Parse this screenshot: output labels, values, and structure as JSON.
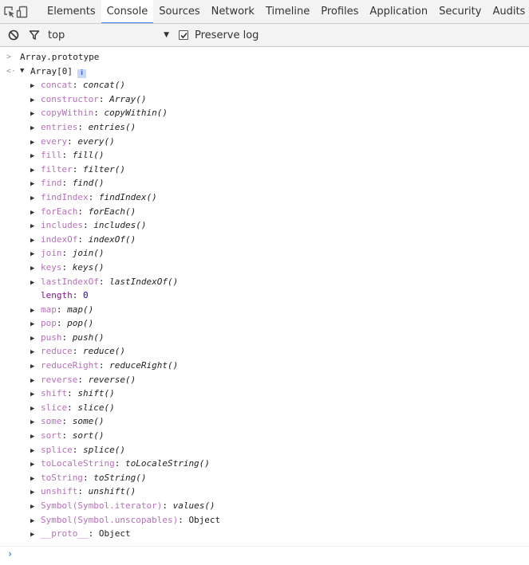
{
  "tabs": [
    {
      "label": "Elements",
      "active": false
    },
    {
      "label": "Console",
      "active": true
    },
    {
      "label": "Sources",
      "active": false
    },
    {
      "label": "Network",
      "active": false
    },
    {
      "label": "Timeline",
      "active": false
    },
    {
      "label": "Profiles",
      "active": false
    },
    {
      "label": "Application",
      "active": false
    },
    {
      "label": "Security",
      "active": false
    },
    {
      "label": "Audits",
      "active": false
    }
  ],
  "toolbar": {
    "context": "top",
    "preserve_log_label": "Preserve log",
    "preserve_log_checked": true
  },
  "console": {
    "input": "Array.prototype",
    "result_head": "Array[0]",
    "info_badge": "i",
    "props": [
      {
        "key": "concat",
        "value": "concat()",
        "kind": "fn",
        "expandable": true
      },
      {
        "key": "constructor",
        "value": "Array()",
        "kind": "fn",
        "expandable": true
      },
      {
        "key": "copyWithin",
        "value": "copyWithin()",
        "kind": "fn",
        "expandable": true
      },
      {
        "key": "entries",
        "value": "entries()",
        "kind": "fn",
        "expandable": true
      },
      {
        "key": "every",
        "value": "every()",
        "kind": "fn",
        "expandable": true
      },
      {
        "key": "fill",
        "value": "fill()",
        "kind": "fn",
        "expandable": true
      },
      {
        "key": "filter",
        "value": "filter()",
        "kind": "fn",
        "expandable": true
      },
      {
        "key": "find",
        "value": "find()",
        "kind": "fn",
        "expandable": true
      },
      {
        "key": "findIndex",
        "value": "findIndex()",
        "kind": "fn",
        "expandable": true
      },
      {
        "key": "forEach",
        "value": "forEach()",
        "kind": "fn",
        "expandable": true
      },
      {
        "key": "includes",
        "value": "includes()",
        "kind": "fn",
        "expandable": true
      },
      {
        "key": "indexOf",
        "value": "indexOf()",
        "kind": "fn",
        "expandable": true
      },
      {
        "key": "join",
        "value": "join()",
        "kind": "fn",
        "expandable": true
      },
      {
        "key": "keys",
        "value": "keys()",
        "kind": "fn",
        "expandable": true
      },
      {
        "key": "lastIndexOf",
        "value": "lastIndexOf()",
        "kind": "fn",
        "expandable": true
      },
      {
        "key": "length",
        "value": "0",
        "kind": "num",
        "expandable": false
      },
      {
        "key": "map",
        "value": "map()",
        "kind": "fn",
        "expandable": true
      },
      {
        "key": "pop",
        "value": "pop()",
        "kind": "fn",
        "expandable": true
      },
      {
        "key": "push",
        "value": "push()",
        "kind": "fn",
        "expandable": true
      },
      {
        "key": "reduce",
        "value": "reduce()",
        "kind": "fn",
        "expandable": true
      },
      {
        "key": "reduceRight",
        "value": "reduceRight()",
        "kind": "fn",
        "expandable": true
      },
      {
        "key": "reverse",
        "value": "reverse()",
        "kind": "fn",
        "expandable": true
      },
      {
        "key": "shift",
        "value": "shift()",
        "kind": "fn",
        "expandable": true
      },
      {
        "key": "slice",
        "value": "slice()",
        "kind": "fn",
        "expandable": true
      },
      {
        "key": "some",
        "value": "some()",
        "kind": "fn",
        "expandable": true
      },
      {
        "key": "sort",
        "value": "sort()",
        "kind": "fn",
        "expandable": true
      },
      {
        "key": "splice",
        "value": "splice()",
        "kind": "fn",
        "expandable": true
      },
      {
        "key": "toLocaleString",
        "value": "toLocaleString()",
        "kind": "fn",
        "expandable": true
      },
      {
        "key": "toString",
        "value": "toString()",
        "kind": "fn",
        "expandable": true
      },
      {
        "key": "unshift",
        "value": "unshift()",
        "kind": "fn",
        "expandable": true
      },
      {
        "key": "Symbol(Symbol.iterator)",
        "value": "values()",
        "kind": "fn",
        "expandable": true
      },
      {
        "key": "Symbol(Symbol.unscopables)",
        "value": "Object",
        "kind": "obj",
        "expandable": true
      },
      {
        "key": "__proto__",
        "value": "Object",
        "kind": "obj",
        "expandable": true
      }
    ]
  },
  "colors": {
    "accent": "#3e82f7",
    "key": "#881391",
    "number": "#1c00cf",
    "prompt": "#367cf1"
  }
}
